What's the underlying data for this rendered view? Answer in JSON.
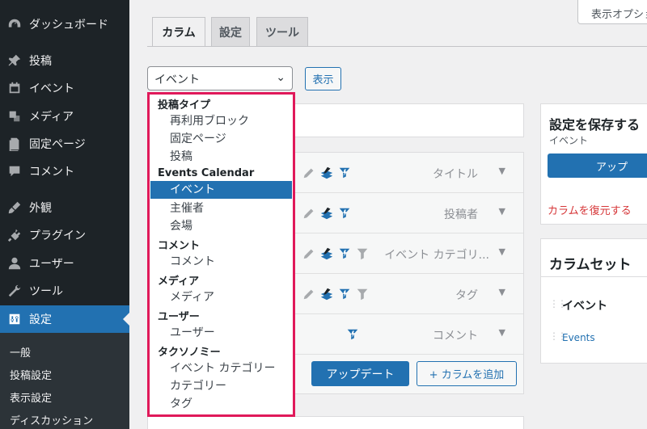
{
  "sidebar": {
    "items": [
      {
        "label": "ダッシュボード",
        "icon": "dashboard-icon"
      },
      {
        "label": "投稿",
        "icon": "pin-icon"
      },
      {
        "label": "イベント",
        "icon": "calendar-icon"
      },
      {
        "label": "メディア",
        "icon": "media-icon"
      },
      {
        "label": "固定ページ",
        "icon": "page-icon"
      },
      {
        "label": "コメント",
        "icon": "comment-icon"
      },
      {
        "label": "外観",
        "icon": "appearance-icon"
      },
      {
        "label": "プラグイン",
        "icon": "plugin-icon"
      },
      {
        "label": "ユーザー",
        "icon": "user-icon"
      },
      {
        "label": "ツール",
        "icon": "tools-icon"
      },
      {
        "label": "設定",
        "icon": "settings-icon"
      }
    ],
    "submenu": [
      "一般",
      "投稿設定",
      "表示設定",
      "ディスカッション"
    ]
  },
  "screen_options": "表示オプション",
  "tabs": [
    "カラム",
    "設定",
    "ツール"
  ],
  "type_select": {
    "value": "イベント",
    "show_button": "表示"
  },
  "dropdown": {
    "groups": [
      {
        "label": "投稿タイプ",
        "options": [
          "再利用ブロック",
          "固定ページ",
          "投稿"
        ]
      },
      {
        "label": "Events Calendar",
        "options": [
          "イベント",
          "主催者",
          "会場"
        ]
      },
      {
        "label": "コメント",
        "options": [
          "コメント"
        ]
      },
      {
        "label": "メディア",
        "options": [
          "メディア"
        ]
      },
      {
        "label": "ユーザー",
        "options": [
          "ユーザー"
        ]
      },
      {
        "label": "タクソノミー",
        "options": [
          "イベント カテゴリー",
          "カテゴリー",
          "タグ"
        ]
      }
    ],
    "selected": "イベント"
  },
  "columns": [
    {
      "label": "タイトル"
    },
    {
      "label": "投稿者"
    },
    {
      "label": "イベント カテゴリ..."
    },
    {
      "label": "タグ"
    },
    {
      "label": "コメント"
    }
  ],
  "buttons": {
    "update": "アップデート",
    "add_column": "+ カラムを追加"
  },
  "save_panel": {
    "title": "設定を保存する",
    "subtitle": "イベント",
    "apply": "アップ",
    "restore": "カラムを復元する"
  },
  "column_sets": {
    "title": "カラムセット",
    "item": "イベント",
    "item_sub": "Events"
  },
  "colors": {
    "accent": "#2271b1",
    "highlight_border": "#e0195a",
    "sidebar_bg": "#1d2327"
  }
}
